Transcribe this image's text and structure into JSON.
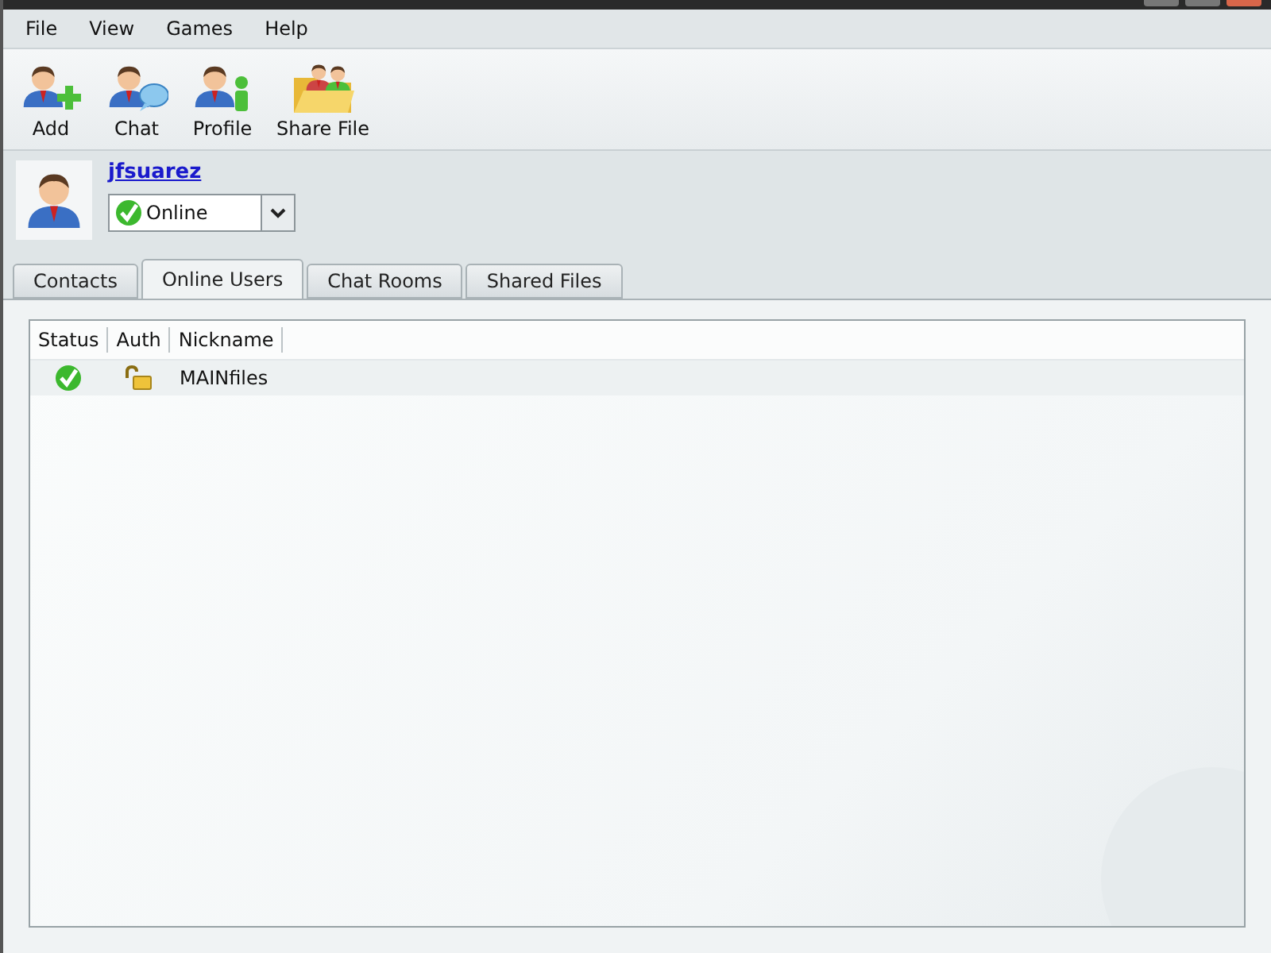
{
  "menu": [
    {
      "label": "File"
    },
    {
      "label": "View"
    },
    {
      "label": "Games"
    },
    {
      "label": "Help"
    }
  ],
  "toolbar": [
    {
      "kind": "add",
      "label": "Add"
    },
    {
      "kind": "chat",
      "label": "Chat"
    },
    {
      "kind": "profile",
      "label": "Profile"
    },
    {
      "kind": "share",
      "label": "Share File"
    }
  ],
  "user": {
    "name": "jfsuarez",
    "status": "Online"
  },
  "tabs": [
    {
      "label": "Contacts",
      "selected": false
    },
    {
      "label": "Online Users",
      "selected": true
    },
    {
      "label": "Chat Rooms",
      "selected": false
    },
    {
      "label": "Shared Files",
      "selected": false
    }
  ],
  "table": {
    "columns": [
      "Status",
      "Auth",
      "Nickname"
    ],
    "rows": [
      {
        "online": true,
        "locked": false,
        "nickname": "MAINfiles"
      }
    ]
  }
}
